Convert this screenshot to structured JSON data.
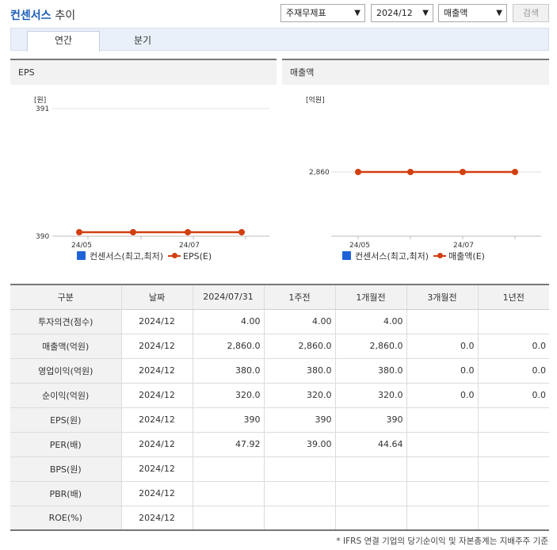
{
  "header": {
    "title_accent": "컨센서스",
    "title_rest": "추이",
    "select_type": "주재무제표",
    "select_period": "2024/12",
    "select_metric": "매출액",
    "search_label": "검색"
  },
  "tabs": [
    {
      "label": "연간",
      "active": true
    },
    {
      "label": "분기",
      "active": false
    }
  ],
  "charts": [
    {
      "panel_title": "EPS",
      "chart_data": {
        "type": "line",
        "unit": "[원]",
        "y_ticks": [
          "391",
          "390"
        ],
        "ylim": [
          390,
          391
        ],
        "x_ticks": [
          "24/05",
          "24/07"
        ],
        "series": [
          {
            "name": "EPS(E)",
            "values": [
              390,
              390,
              390,
              390
            ]
          }
        ],
        "legend": [
          "컨센서스(최고,최저)",
          "EPS(E)"
        ],
        "series_color": "#d23f10"
      }
    },
    {
      "panel_title": "매출액",
      "chart_data": {
        "type": "line",
        "unit": "[억원]",
        "y_ticks": [
          "2,860"
        ],
        "x_ticks": [
          "24/05",
          "24/07"
        ],
        "series": [
          {
            "name": "매출액(E)",
            "values": [
              2860,
              2860,
              2860,
              2860
            ]
          }
        ],
        "legend": [
          "컨센서스(최고,최저)",
          "매출액(E)"
        ],
        "series_color": "#d23f10"
      }
    }
  ],
  "table": {
    "headers": [
      "구분",
      "날짜",
      "2024/07/31",
      "1주전",
      "1개월전",
      "3개월전",
      "1년전"
    ],
    "rows": [
      {
        "label": "투자의견(점수)",
        "date": "2024/12",
        "values": [
          "4.00",
          "4.00",
          "4.00",
          "",
          ""
        ]
      },
      {
        "label": "매출액(억원)",
        "date": "2024/12",
        "values": [
          "2,860.0",
          "2,860.0",
          "2,860.0",
          "0.0",
          "0.0"
        ]
      },
      {
        "label": "영업이익(억원)",
        "date": "2024/12",
        "values": [
          "380.0",
          "380.0",
          "380.0",
          "0.0",
          "0.0"
        ]
      },
      {
        "label": "순이익(억원)",
        "date": "2024/12",
        "values": [
          "320.0",
          "320.0",
          "320.0",
          "0.0",
          "0.0"
        ]
      },
      {
        "label": "EPS(원)",
        "date": "2024/12",
        "values": [
          "390",
          "390",
          "390",
          "",
          ""
        ]
      },
      {
        "label": "PER(배)",
        "date": "2024/12",
        "values": [
          "47.92",
          "39.00",
          "44.64",
          "",
          ""
        ]
      },
      {
        "label": "BPS(원)",
        "date": "2024/12",
        "values": [
          "",
          "",
          "",
          "",
          ""
        ]
      },
      {
        "label": "PBR(배)",
        "date": "2024/12",
        "values": [
          "",
          "",
          "",
          "",
          ""
        ]
      },
      {
        "label": "ROE(%)",
        "date": "2024/12",
        "values": [
          "",
          "",
          "",
          "",
          ""
        ]
      }
    ]
  },
  "footnote": "* IFRS 연결 기업의 당기순이익 및 자본총계는 지배주주 기준"
}
